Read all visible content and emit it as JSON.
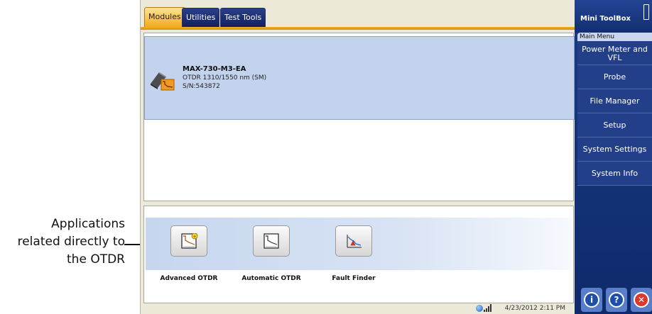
{
  "callout": {
    "line1": "Applications",
    "line2": "related directly to",
    "line3": "the OTDR"
  },
  "tabs": [
    {
      "label": "Modules",
      "active": true
    },
    {
      "label": "Utilities",
      "active": false
    },
    {
      "label": "Test Tools",
      "active": false
    }
  ],
  "module": {
    "name": "MAX-730-M3-EA",
    "description": "OTDR 1310/1550 nm (SM)",
    "serial": "S/N:543872"
  },
  "apps": [
    {
      "label": "Advanced OTDR",
      "icon": "advanced-otdr-icon"
    },
    {
      "label": "Automatic OTDR",
      "icon": "automatic-otdr-icon"
    },
    {
      "label": "Fault Finder",
      "icon": "fault-finder-icon"
    }
  ],
  "status": {
    "datetime": "4/23/2012 2:11 PM"
  },
  "toolbox": {
    "title": "Mini ToolBox",
    "menu_caption": "Main Menu",
    "menu": [
      "Power Meter and VFL",
      "Probe",
      "File Manager",
      "Setup",
      "System Settings",
      "System Info"
    ]
  },
  "colors": {
    "active_tab": "#f1a917",
    "inactive_tab": "#12205c",
    "selection": "#c3d3ee",
    "toolbox": "#1a3b86",
    "close_button": "#d93a2d"
  }
}
